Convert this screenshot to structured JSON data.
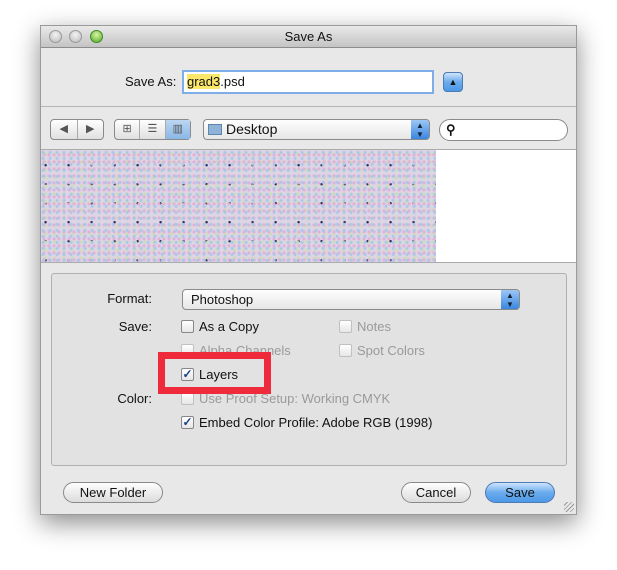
{
  "window": {
    "title": "Save As"
  },
  "save_as": {
    "label": "Save As:",
    "filename_selected": "grad3",
    "filename_ext": ".psd",
    "collapse_icon": "triangle-up-icon"
  },
  "toolbar": {
    "back_icon": "◀",
    "forward_icon": "▶",
    "view_icons": "⊞",
    "view_list": "☰",
    "view_columns": "▥",
    "location": "Desktop",
    "search_placeholder": ""
  },
  "options": {
    "format_label": "Format:",
    "format_value": "Photoshop",
    "save_label": "Save:",
    "color_label": "Color:",
    "checkboxes": [
      {
        "label": "As a Copy",
        "checked": false,
        "enabled": true
      },
      {
        "label": "Notes",
        "checked": false,
        "enabled": false
      },
      {
        "label": "Alpha Channels",
        "checked": false,
        "enabled": false
      },
      {
        "label": "Spot Colors",
        "checked": false,
        "enabled": false
      },
      {
        "label": "Layers",
        "checked": true,
        "enabled": true
      },
      {
        "label": "Use Proof Setup:  Working CMYK",
        "checked": false,
        "enabled": false
      },
      {
        "label": "Embed Color Profile:  Adobe RGB (1998)",
        "checked": true,
        "enabled": true
      }
    ]
  },
  "buttons": {
    "new_folder": "New Folder",
    "cancel": "Cancel",
    "save": "Save"
  },
  "colors": {
    "highlight": "#ef2b3b",
    "default_button": "#4c98e6"
  }
}
